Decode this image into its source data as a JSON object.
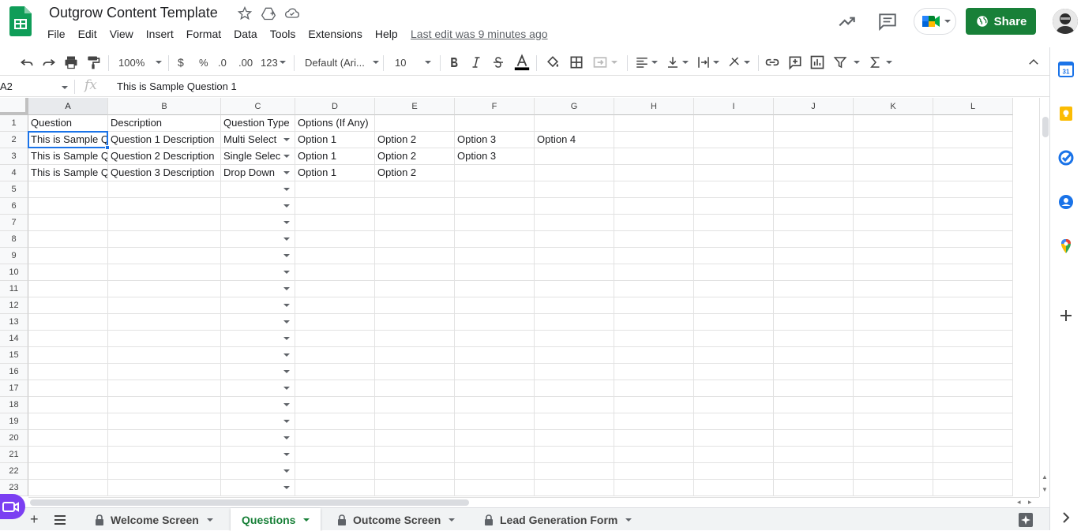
{
  "app": {
    "title": "Outgrow Content Template",
    "menu": [
      "File",
      "Edit",
      "View",
      "Insert",
      "Format",
      "Data",
      "Tools",
      "Extensions",
      "Help"
    ],
    "last_edit": "Last edit was 9 minutes ago",
    "share_label": "Share"
  },
  "toolbar": {
    "zoom": "100%",
    "currency": "$",
    "percent": "%",
    "decimal_decrease": ".0",
    "decimal_increase": ".00",
    "more_formats": "123",
    "font": "Default (Ari...",
    "font_size": "10"
  },
  "formula_bar": {
    "name_box": "A2",
    "fx": "fx",
    "content": "This is Sample Question 1"
  },
  "grid": {
    "columns": [
      "A",
      "B",
      "C",
      "D",
      "E",
      "F",
      "G",
      "H",
      "I",
      "J",
      "K",
      "L"
    ],
    "selected_column": "A",
    "rows": [
      [
        "Question",
        "Description",
        "Question Type",
        "Options (If Any)",
        "",
        "",
        ""
      ],
      [
        "This is Sample Q",
        "Question 1 Description",
        "Multi Select",
        "Option 1",
        "Option 2",
        "Option 3",
        "Option 4"
      ],
      [
        "This is Sample Q",
        "Question 2 Description",
        "Single Selec",
        "Option 1",
        "Option 2",
        "Option 3",
        ""
      ],
      [
        "This is Sample Q",
        "Question 3 Description",
        "Drop Down",
        "Option 1",
        "Option 2",
        "",
        ""
      ]
    ],
    "row_numbers": [
      "1",
      "2",
      "3",
      "4",
      "5",
      "6",
      "7",
      "8",
      "9",
      "10",
      "11",
      "12",
      "13",
      "14",
      "15",
      "16",
      "17",
      "18",
      "19",
      "20",
      "21",
      "22",
      "23"
    ]
  },
  "sheets": [
    {
      "name": "Welcome Screen",
      "locked": true,
      "active": false
    },
    {
      "name": "Questions",
      "locked": false,
      "active": true
    },
    {
      "name": "Outcome Screen",
      "locked": true,
      "active": false
    },
    {
      "name": "Lead Generation Form",
      "locked": true,
      "active": false
    }
  ],
  "colors": {
    "share_green": "#188038",
    "selection_blue": "#1a73e8",
    "active_tab_text": "#188038"
  }
}
